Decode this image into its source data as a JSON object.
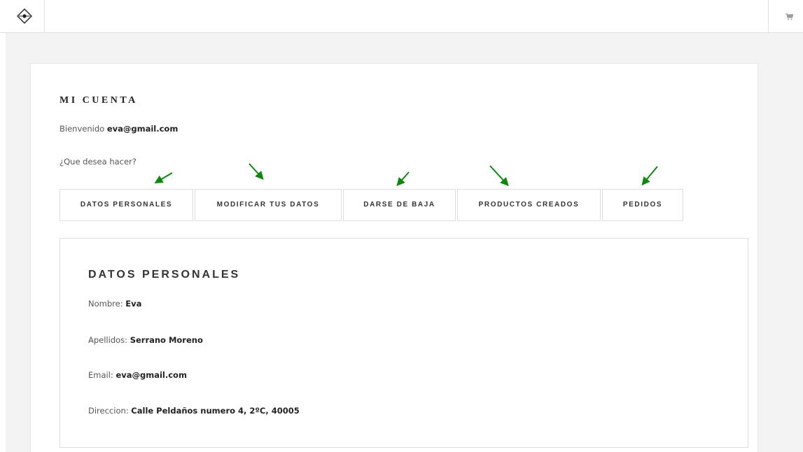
{
  "header": {
    "logo_icon": "diamond-logo-icon",
    "cart_icon": "cart-icon"
  },
  "account": {
    "title": "MI CUENTA",
    "welcome_prefix": "Bienvenido",
    "user_email": "eva@gmail.com",
    "question": "¿Que desea hacer?"
  },
  "tabs": [
    {
      "label": "DATOS PERSONALES"
    },
    {
      "label": "MODIFICAR TUS DATOS"
    },
    {
      "label": "DARSE DE BAJA"
    },
    {
      "label": "PRODUCTOS CREADOS"
    },
    {
      "label": "PEDIDOS"
    }
  ],
  "annotation_color": "#0a8a0a",
  "personal_data": {
    "title": "DATOS PERSONALES",
    "fields": [
      {
        "label": "Nombre:",
        "value": "Eva"
      },
      {
        "label": "Apellidos:",
        "value": "Serrano Moreno"
      },
      {
        "label": "Email:",
        "value": "eva@gmail.com"
      },
      {
        "label": "Direccion:",
        "value": "Calle Peldaños numero 4, 2ºC, 40005"
      }
    ]
  }
}
